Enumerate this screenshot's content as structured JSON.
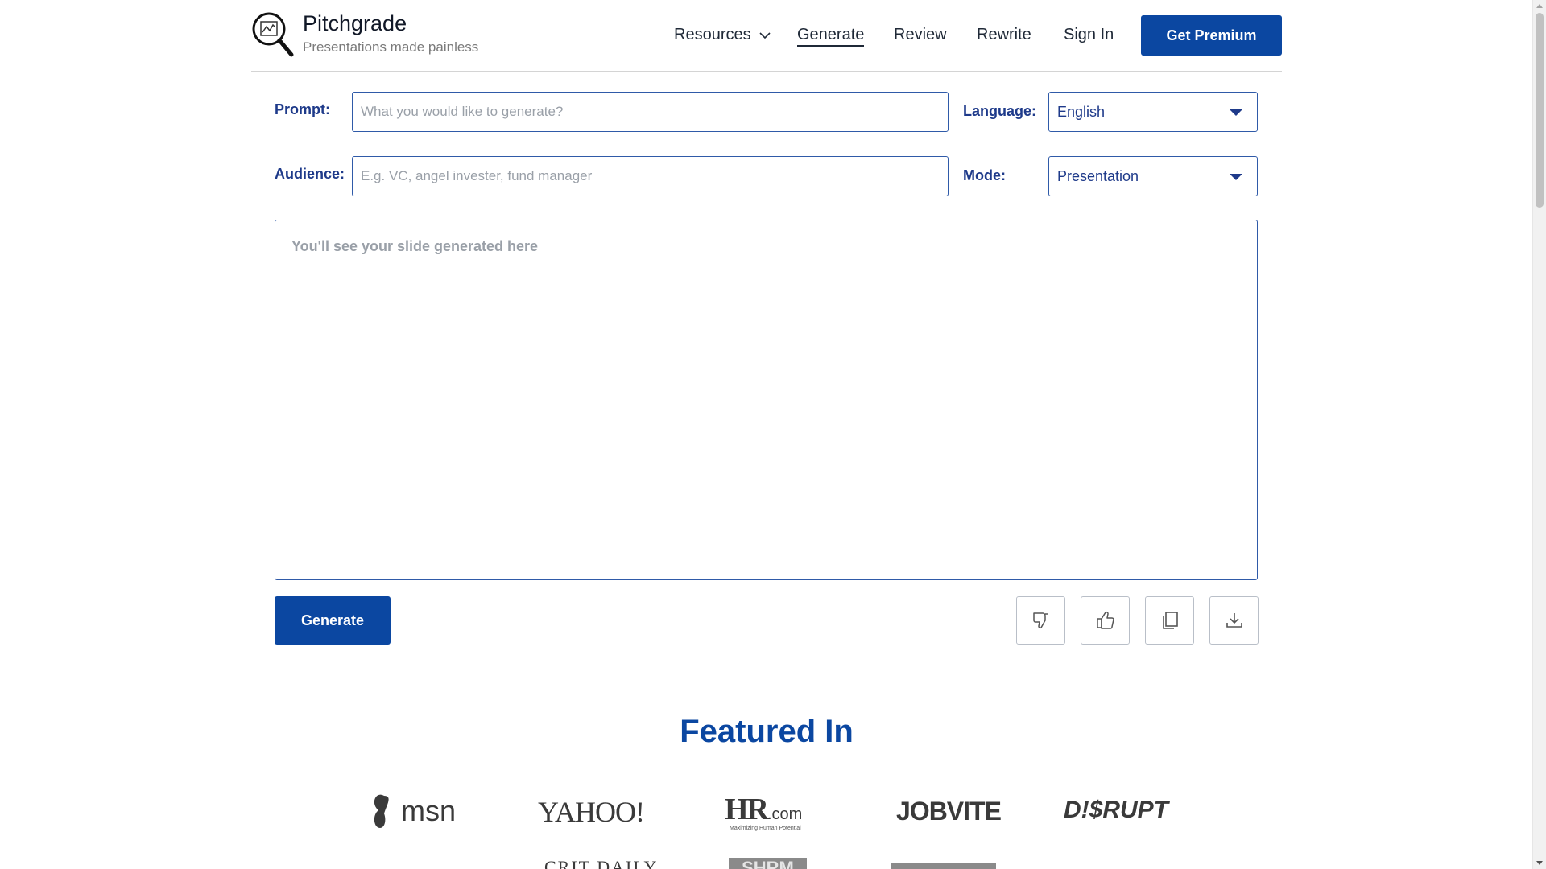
{
  "brand": {
    "name": "Pitchgrade",
    "tagline": "Presentations made painless",
    "logo_icon": "magnifier-chart-icon"
  },
  "nav": {
    "resources": "Resources",
    "generate": "Generate",
    "review": "Review",
    "rewrite": "Rewrite",
    "sign_in": "Sign In",
    "premium": "Get Premium",
    "active": "Generate"
  },
  "form": {
    "prompt_label": "Prompt:",
    "prompt_placeholder": "What you would like to generate?",
    "prompt_value": "",
    "audience_label": "Audience:",
    "audience_placeholder": "E.g. VC, angel invester, fund manager",
    "audience_value": "",
    "language_label": "Language:",
    "language_value": "English",
    "mode_label": "Mode:",
    "mode_value": "Presentation"
  },
  "output": {
    "placeholder": "You'll see your slide generated here"
  },
  "actions": {
    "generate": "Generate",
    "icons": [
      "thumbs-down-icon",
      "thumbs-up-icon",
      "copy-icon",
      "download-icon"
    ]
  },
  "featured": {
    "title": "Featured In",
    "logos": {
      "msn": "msn",
      "yahoo": "YAHOO!",
      "hr_main": "HR",
      "hr_com": ".com",
      "hr_sub": "Maximizing Human Potential",
      "jobvite": "JOBVITE",
      "disrupt": "D!$RUPT",
      "crit": "CRIT DAILY",
      "shrm": "SHRM"
    }
  },
  "colors": {
    "primary": "#0b47a1",
    "label": "#1e3a8a",
    "border": "#2f5aa8",
    "placeholder": "#9aa0a8"
  }
}
